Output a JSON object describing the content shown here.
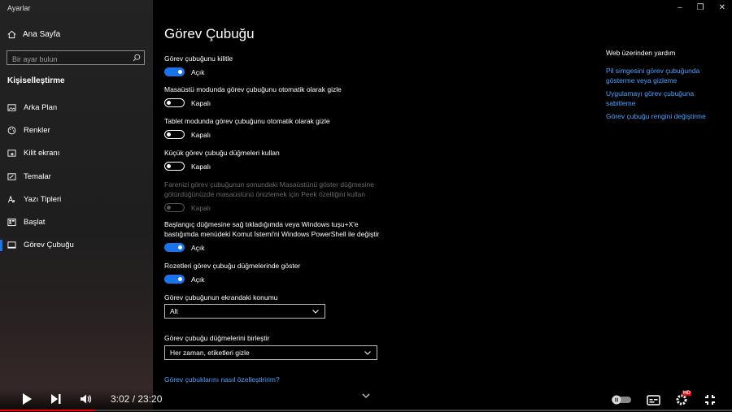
{
  "window": {
    "app_title": "Ayarlar",
    "minimize_icon": "minimize-icon",
    "maximize_icon": "maximize-icon",
    "close_icon": "close-icon"
  },
  "sidebar": {
    "home_label": "Ana Sayfa",
    "search_placeholder": "Bir ayar bulun",
    "section_title": "Kişiselleştirme",
    "items": [
      {
        "label": "Arka Plan",
        "icon": "image-icon"
      },
      {
        "label": "Renkler",
        "icon": "palette-icon"
      },
      {
        "label": "Kilit ekranı",
        "icon": "lock-screen-icon"
      },
      {
        "label": "Temalar",
        "icon": "theme-icon"
      },
      {
        "label": "Yazı Tipleri",
        "icon": "font-icon"
      },
      {
        "label": "Başlat",
        "icon": "start-icon"
      },
      {
        "label": "Görev Çubuğu",
        "icon": "taskbar-icon",
        "active": true
      }
    ]
  },
  "main": {
    "title": "Görev Çubuğu",
    "settings": [
      {
        "label": "Görev çubuğunu kilitle",
        "state": "Açık",
        "on": true
      },
      {
        "label": "Masaüstü modunda görev çubuğunu otomatik olarak gizle",
        "state": "Kapalı",
        "on": false
      },
      {
        "label": "Tablet modunda görev çubuğunu otomatik olarak gizle",
        "state": "Kapalı",
        "on": false
      },
      {
        "label": "Küçük görev çubuğu düğmeleri kullan",
        "state": "Kapalı",
        "on": false
      },
      {
        "label_line1": "Farenizi görev çubuğunun sonundaki Masaüstünü göster düğmesine",
        "label_line2": "götürdüğünüzde masaüstünü önizlemek için Peek özelliğini kullan",
        "state": "Kapalı",
        "on": false,
        "disabled": true
      },
      {
        "label_line1": "Başlangıç düğmesine sağ tıkladığımda veya Windows tuşu+X'e",
        "label_line2": "bastığımda menüdeki Komut İstemi'ni Windows PowerShell ile değiştir",
        "state": "Açık",
        "on": true
      },
      {
        "label": "Rozetleri görev çubuğu düğmelerinde göster",
        "state": "Açık",
        "on": true
      }
    ],
    "position_label": "Görev çubuğunun ekrandaki konumu",
    "position_value": "Alt",
    "combine_label": "Görev çubuğu düğmelerini birleştir",
    "combine_value": "Her zaman, etiketleri gizle",
    "customize_link": "Görev çubuklarını nasıl özelleştiririm?"
  },
  "help": {
    "title": "Web üzerinden yardım",
    "link1_line1": "Pil simgesini görev çubuğunda",
    "link1_line2": "gösterme veya gizleme",
    "link2_line1": "Uygulamayı görev çubuğuna",
    "link2_line2": "sabitleme",
    "link3": "Görev çubuğu rengini değiştirme"
  },
  "player": {
    "time": "3:02 / 23:20",
    "progress": 0.13,
    "hd_badge": "HD",
    "accent": "#ff0000"
  }
}
